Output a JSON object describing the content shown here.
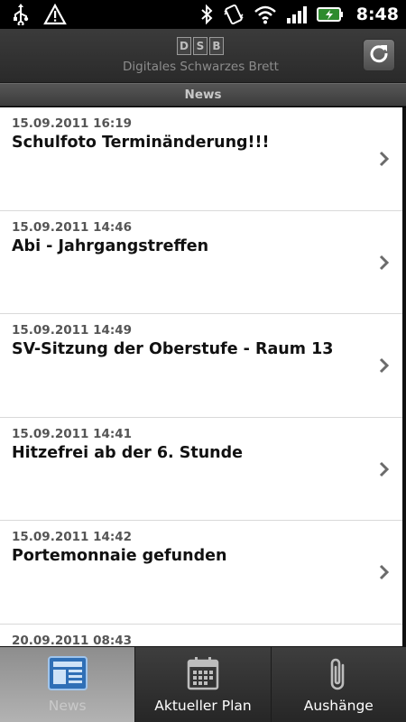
{
  "status_bar": {
    "time": "8:48",
    "icons": [
      "usb-icon",
      "warning-icon",
      "bluetooth-icon",
      "vibrate-icon",
      "wifi-icon",
      "signal-icon",
      "battery-icon"
    ]
  },
  "header": {
    "logo_letters": [
      "D",
      "S",
      "B"
    ],
    "subtitle": "Digitales Schwarzes Brett",
    "refresh_icon": "refresh-icon"
  },
  "section": {
    "title": "News"
  },
  "news": [
    {
      "date": "15.09.2011 16:19",
      "title": "Schulfoto Terminänderung!!!"
    },
    {
      "date": "15.09.2011 14:46",
      "title": "Abi - Jahrgangstreffen"
    },
    {
      "date": "15.09.2011 14:49",
      "title": "SV-Sitzung der Oberstufe - Raum 13"
    },
    {
      "date": "15.09.2011 14:41",
      "title": "Hitzefrei ab der 6. Stunde"
    },
    {
      "date": "15.09.2011 14:42",
      "title": "Portemonnaie gefunden"
    },
    {
      "date": "20.09.2011 08:43",
      "title": ""
    }
  ],
  "tabs": [
    {
      "label": "News",
      "icon": "newspaper-icon",
      "active": true
    },
    {
      "label": "Aktueller Plan",
      "icon": "calendar-icon",
      "active": false
    },
    {
      "label": "Aushänge",
      "icon": "paperclip-icon",
      "active": false
    }
  ],
  "colors": {
    "accent_active_tab": "#9e9e9e",
    "header_bg": "#333333",
    "list_bg": "#ffffff"
  }
}
